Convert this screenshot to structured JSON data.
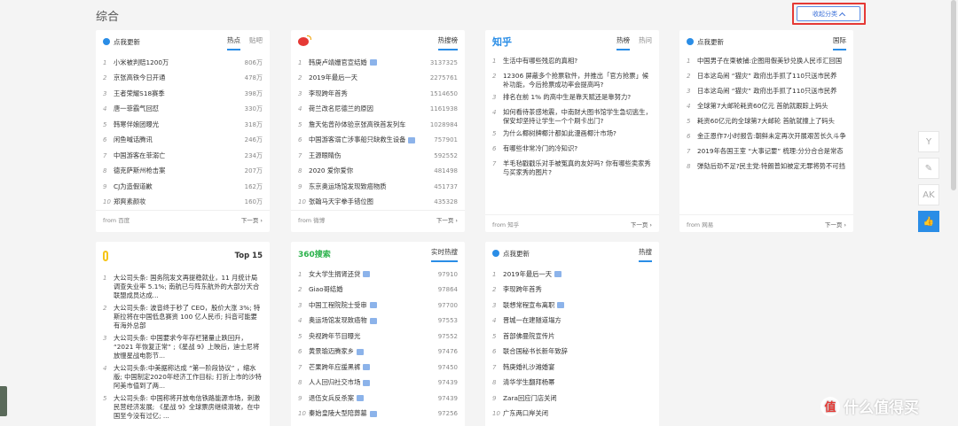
{
  "page": {
    "title": "综合",
    "collapse_label": "收起分类"
  },
  "cards": [
    {
      "brand": "点我更新",
      "tabs": [
        "热点",
        "贴吧"
      ],
      "items": [
        {
          "rank": "1",
          "title": "小米被判赔1200万",
          "value": "806万"
        },
        {
          "rank": "2",
          "title": "京张高铁今日开通",
          "value": "478万"
        },
        {
          "rank": "3",
          "title": "王者荣耀S18赛季",
          "value": "398万"
        },
        {
          "rank": "4",
          "title": "唐一菲霸气回怼",
          "value": "330万"
        },
        {
          "rank": "5",
          "title": "韩寒伴娘团曝光",
          "value": "318万"
        },
        {
          "rank": "6",
          "title": "闲鱼喊话腾讯",
          "value": "246万"
        },
        {
          "rank": "7",
          "title": "中国游客在菲溺亡",
          "value": "234万"
        },
        {
          "rank": "8",
          "title": "德克萨斯州枪击案",
          "value": "207万"
        },
        {
          "rank": "9",
          "title": "CJ为造假道歉",
          "value": "162万"
        },
        {
          "rank": "10",
          "title": "郑爽素颜妆",
          "value": "160万"
        }
      ],
      "source": "from 百度",
      "next": "下一页"
    },
    {
      "brand": "",
      "tabs": [
        "热搜榜"
      ],
      "items": [
        {
          "rank": "1",
          "title": "韩庚卢靖姗官宣结婚",
          "value": "3137325",
          "badge": true
        },
        {
          "rank": "2",
          "title": "2019年最后一天",
          "value": "2275761"
        },
        {
          "rank": "3",
          "title": "李现跨年首秀",
          "value": "1514650"
        },
        {
          "rank": "4",
          "title": "荷兰改名尼德兰的原因",
          "value": "1161938"
        },
        {
          "rank": "5",
          "title": "詹天佑曾孙体验京张高铁首发列车",
          "value": "1028984"
        },
        {
          "rank": "6",
          "title": "中国游客溺亡涉事船只缺救生设备",
          "value": "757901",
          "badge": true
        },
        {
          "rank": "7",
          "title": "王源眼睛伤",
          "value": "592552"
        },
        {
          "rank": "8",
          "title": "2020 爱你爱你",
          "value": "481498"
        },
        {
          "rank": "9",
          "title": "东京奥运场馆发现致癌物质",
          "value": "451737"
        },
        {
          "rank": "10",
          "title": "张翰马天宇拳手错位图",
          "value": "435328"
        }
      ],
      "source": "from 微博",
      "next": "下一页"
    },
    {
      "brand": "知乎",
      "tabs": [
        "热榜",
        "热问"
      ],
      "items": [
        {
          "rank": "1",
          "title": "生活中有哪些残忍的真相?"
        },
        {
          "rank": "2",
          "title": "12306 屏蔽多个抢票软件，并推出「官方抢票」候补功能，今后抢票成功率会提高吗?"
        },
        {
          "rank": "3",
          "title": "排名在前 1% 的高中生是靠天赋还是靠努力?"
        },
        {
          "rank": "4",
          "title": "如何看待茶感地震，中南财大图书馆学生急切逃生，保安却坚持让学生一个个刷卡出门?"
        },
        {
          "rank": "5",
          "title": "为什么椰树牌椰汁都如此漫画椰汁市场?"
        },
        {
          "rank": "6",
          "title": "有哪些非常冷门的冷知识?"
        },
        {
          "rank": "7",
          "title": "羊毛毡戳戳乐对手被冤真的友好吗? 你有哪些卖家秀与买家秀的图片?"
        }
      ],
      "source": "from 知乎",
      "next": "下一页"
    },
    {
      "brand": "点我更新",
      "tabs": [
        "国际"
      ],
      "items": [
        {
          "rank": "1",
          "title": "中国男子在柬被捕:企图用假美钞兑换人民币汇回国"
        },
        {
          "rank": "2",
          "title": "日本这岛闹 “猫灾” 政府出手抓了110只送市民养"
        },
        {
          "rank": "3",
          "title": "日本这岛闹 “猫灾” 政府出手抓了110只送市民养"
        },
        {
          "rank": "4",
          "title": "全球第7大邮轮耗资60亿元 首航就跟踪上码头"
        },
        {
          "rank": "5",
          "title": "耗资60亿元的全球第7大邮轮 首航就撞上了码头"
        },
        {
          "rank": "6",
          "title": "金正恩作7小时报告:朝鲜未定再次开展艰苦长久斗争"
        },
        {
          "rank": "7",
          "title": "2019年各国王室 “大事记要” 梳理:分分合合是常态"
        },
        {
          "rank": "8",
          "title": "弹劾后劲不足?民主党:特朗普如被定无罪将势不可挡"
        }
      ],
      "source": "from 网易",
      "next": "下一页"
    },
    {
      "brand": "Top 15",
      "tabs": [],
      "items": [
        {
          "rank": "1",
          "title": "大公司头条: 国务院发文再提稳就业，11 月统计局调查失业率 5.1%; 南航已与阵东航外的大部分天合联盟成员达成..."
        },
        {
          "rank": "2",
          "title": "大公司头条: 波音终于秒了 CEO，股价大涨 3%; 特斯拉将在中国低息赛资 100 亿人民币; 抖音可能要有海外总部"
        },
        {
          "rank": "3",
          "title": "大公司头条: 中国要求今年存栏猪量止跌回升， “2021 年恢复正常” ;《星战 9》上映后，迪士尼将放慢星战电影节..."
        },
        {
          "rank": "4",
          "title": "大公司头条:中美据称达成 “第一阶段协议” ，缩水版; 中国制定2020年经济工作目标; 打折上市的沙特阿美市值到了两..."
        },
        {
          "rank": "5",
          "title": "大公司头条: 中国称将开放电信铁路能源市场，刺激民营经济发展; 《星战 9》全球票房继续滑坡，在中国至今没有过亿; ..."
        }
      ]
    },
    {
      "brand": "360搜索",
      "tabs": [
        "实时热搜"
      ],
      "items": [
        {
          "rank": "1",
          "title": "女大学生捐肾还贷",
          "value": "97910",
          "badge": true
        },
        {
          "rank": "2",
          "title": "Giao哥结婚",
          "value": "97864"
        },
        {
          "rank": "3",
          "title": "中国工程院院士受审",
          "value": "97700",
          "badge": true
        },
        {
          "rank": "4",
          "title": "奥运场馆发现致癌物",
          "value": "97553",
          "badge": true
        },
        {
          "rank": "5",
          "title": "央视跨年节目曝光",
          "value": "97552"
        },
        {
          "rank": "6",
          "title": "黄景瑜迈腾家乡",
          "value": "97476",
          "badge": true
        },
        {
          "rank": "7",
          "title": "芒果跨年应援黑裤",
          "value": "97450",
          "badge": true
        },
        {
          "rank": "8",
          "title": "人人回归社交市场",
          "value": "97439",
          "badge": true
        },
        {
          "rank": "9",
          "title": "退伍女兵反杀案",
          "value": "97439",
          "badge": true
        },
        {
          "rank": "10",
          "title": "秦始皇陵大型陪葬墓",
          "value": "97256",
          "badge": true
        }
      ]
    },
    {
      "brand": "点我更新",
      "tabs": [
        "热搜"
      ],
      "items": [
        {
          "rank": "1",
          "title": "2019年最后一天",
          "badge": true
        },
        {
          "rank": "2",
          "title": "李现跨年首秀"
        },
        {
          "rank": "3",
          "title": "联想常程宣布离职",
          "badge": true
        },
        {
          "rank": "4",
          "title": "晋城一在建隧道塌方"
        },
        {
          "rank": "5",
          "title": "首部佛曼院宣传片"
        },
        {
          "rank": "6",
          "title": "联合国秘书长新年致辞"
        },
        {
          "rank": "7",
          "title": "韩庚婚礼沙滩婚宴"
        },
        {
          "rank": "8",
          "title": "清华学生翻拜杨幂"
        },
        {
          "rank": "9",
          "title": "Zara回应门店关闭"
        },
        {
          "rank": "10",
          "title": "广东两口岸关闭"
        }
      ]
    }
  ],
  "sidebar": {
    "buttons": [
      "Y",
      "✎",
      "AK",
      "👍"
    ]
  },
  "watermark": {
    "icon": "值",
    "text": "什么值得买"
  }
}
